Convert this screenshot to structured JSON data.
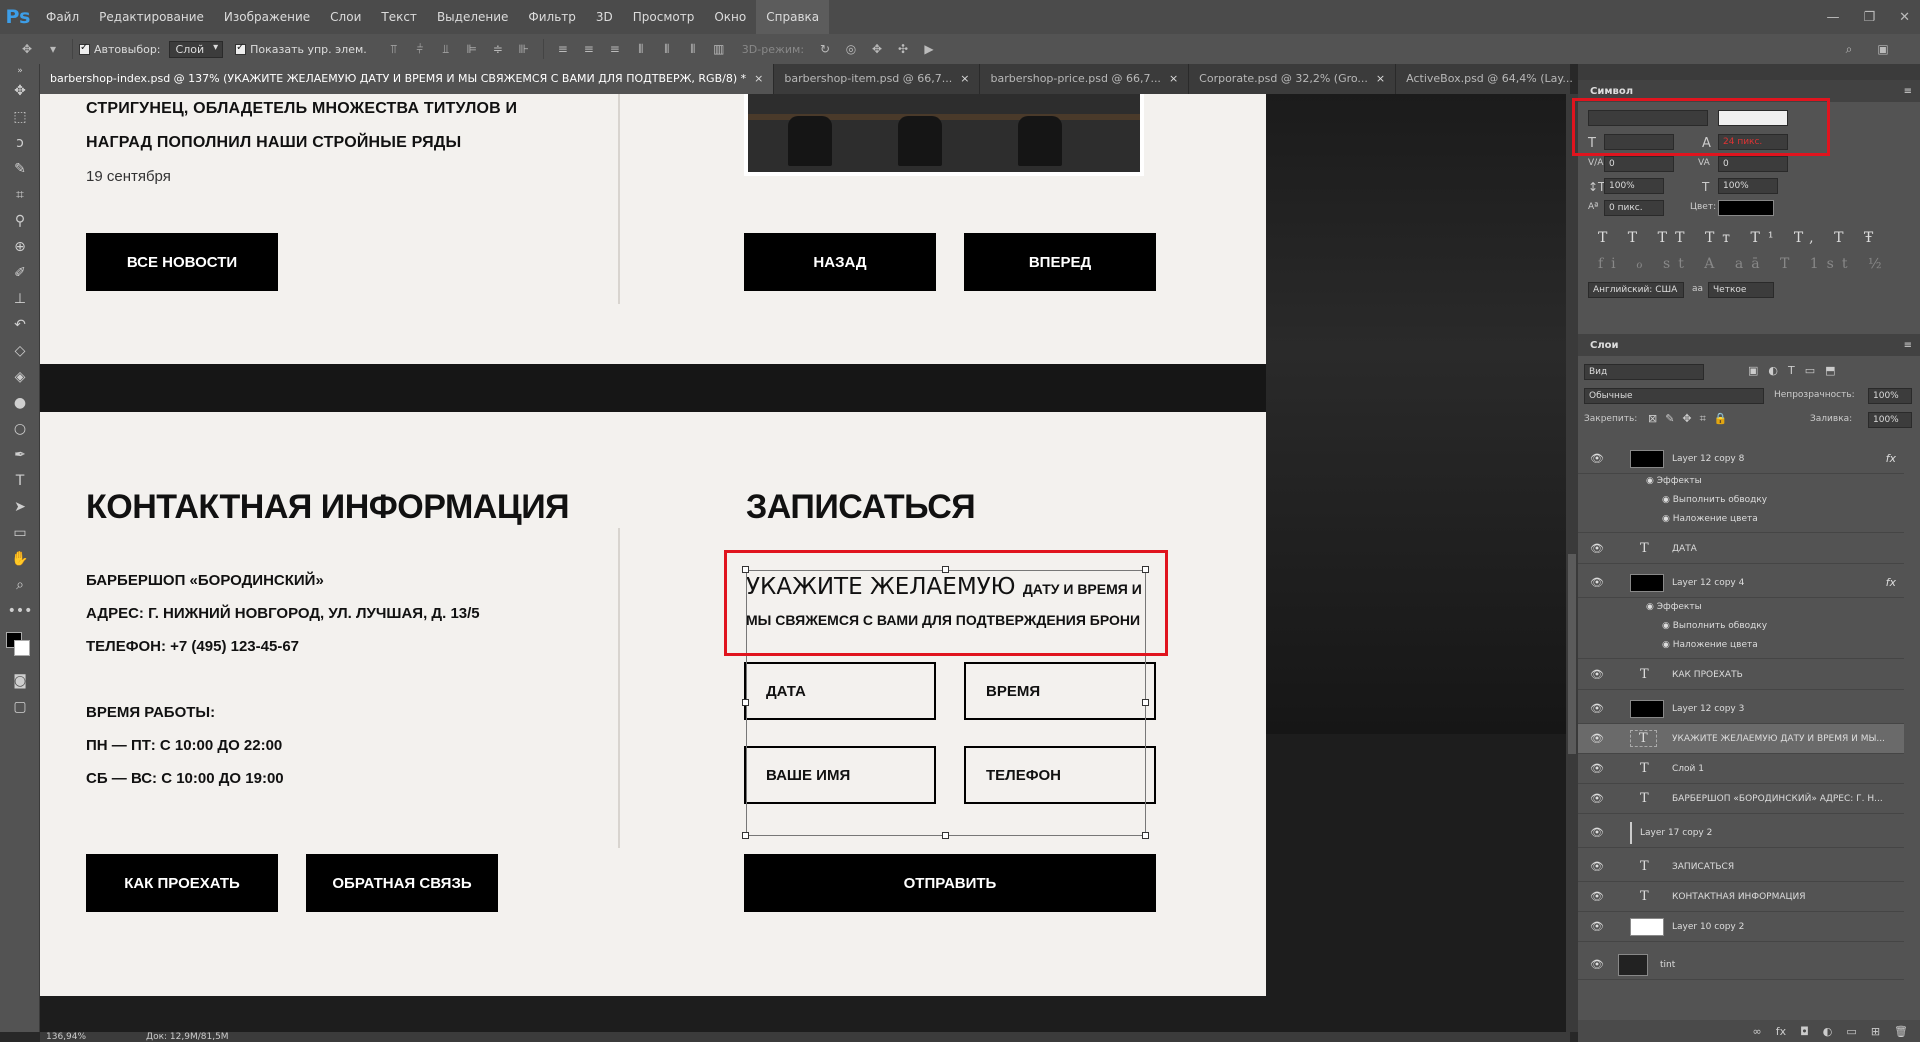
{
  "app": {
    "logo": "Ps"
  },
  "menu": [
    "Файл",
    "Редактирование",
    "Изображение",
    "Слои",
    "Текст",
    "Выделение",
    "Фильтр",
    "3D",
    "Просмотр",
    "Окно",
    "Справка"
  ],
  "options": {
    "autoselect_label": "Автовыбор:",
    "autoselect_value": "Слой",
    "show_controls_label": "Показать упр. элем.",
    "mode_3d": "3D-режим:"
  },
  "tabs": [
    {
      "label": "barbershop-index.psd @ 137% (УКАЖИТЕ ЖЕЛАЕМУЮ ДАТУ И ВРЕМЯ И МЫ СВЯЖЕМСЯ С ВАМИ ДЛЯ ПОДТВЕРЖ, RGB/8) *"
    },
    {
      "label": "barbershop-item.psd @ 66,7..."
    },
    {
      "label": "barbershop-price.psd @ 66,7..."
    },
    {
      "label": "Corporate.psd @ 32,2% (Gro..."
    },
    {
      "label": "ActiveBox.psd @ 64,4% (Lay..."
    }
  ],
  "doc": {
    "news_line1": "СТРИГУНЕЦ, ОБЛАДЕТЕЛЬ МНОЖЕСТВА ТИТУЛОВ И",
    "news_line2": "НАГРАД ПОПОЛНИЛ НАШИ СТРОЙНЫЕ РЯДЫ",
    "news_date": "19 сентября",
    "btn_all_news": "ВСЕ НОВОСТИ",
    "btn_back": "НАЗАД",
    "btn_forward": "ВПЕРЕД",
    "contact_heading": "КОНТАКТНАЯ ИНФОРМАЦИЯ",
    "signup_heading": "ЗАПИСАТЬСЯ",
    "shop_name": "БАРБЕРШОП «БОРОДИНСКИЙ»",
    "address": "АДРЕС: Г. НИЖНИЙ НОВГОРОД, УЛ. ЛУЧШАЯ, Д. 13/5",
    "phone": "ТЕЛЕФОН: +7 (495) 123-45-67",
    "hours_label": "ВРЕМЯ РАБОТЫ:",
    "hours_weekdays": "ПН — ПТ: С 10:00 ДО 22:00",
    "hours_weekend": "СБ — ВС: С 10:00 ДО 19:00",
    "form_text_big": "УКАЖИТЕ ЖЕЛАЕМУЮ",
    "form_text_small": "ДАТУ И ВРЕМЯ И",
    "form_text_line2": "МЫ СВЯЖЕМСЯ С ВАМИ ДЛЯ ПОДТВЕРЖДЕНИЯ БРОНИ",
    "field_date": "ДАТА",
    "field_time": "ВРЕМЯ",
    "field_name": "ВАШЕ ИМЯ",
    "field_phone": "ТЕЛЕФОН",
    "btn_directions": "КАК ПРОЕХАТЬ",
    "btn_feedback": "ОБРАТНАЯ СВЯЗЬ",
    "btn_submit": "ОТПРАВИТЬ"
  },
  "status": {
    "zoom": "136,94%",
    "doc": "Док: 12,9M/81,5M"
  },
  "char_panel": {
    "title": "Символ",
    "size": "24 пикс.",
    "tracking": "0",
    "kerning": "0",
    "vscale": "100%",
    "hscale": "100%",
    "baseline": "0 пикс.",
    "color_label": "Цвет:",
    "language": "Английский: США",
    "aa_label": "аа",
    "antialias": "Четкое",
    "typo_row1": "T T TT Tт T¹ T, T Ŧ",
    "typo_row2": "fi ℴ st A aā T 1st ½"
  },
  "layers_panel": {
    "title": "Слои",
    "filter": "Вид",
    "blend_mode": "Обычные",
    "opacity_label": "Непрозрачность:",
    "opacity": "100%",
    "lock_label": "Закрепить:",
    "fill_label": "Заливка:",
    "fill": "100%",
    "effects_label": "Эффекты",
    "stroke_label": "Выполнить обводку",
    "color_overlay_label": "Наложение цвета",
    "fx_label": "fx",
    "layers": [
      {
        "name": "Layer 12 copy 8",
        "kind": "pixel",
        "fx": true
      },
      {
        "name": "ДАТА",
        "kind": "text"
      },
      {
        "name": "Layer 12 copy 4",
        "kind": "pixel",
        "fx": true
      },
      {
        "name": "КАК ПРОЕХАТЬ",
        "kind": "text"
      },
      {
        "name": "Layer 12 copy 3",
        "kind": "pixel"
      },
      {
        "name": "УКАЖИТЕ ЖЕЛАЕМУЮ ДАТУ И ВРЕМЯ И МЫ...",
        "kind": "text",
        "selected": true
      },
      {
        "name": "Слой 1",
        "kind": "text"
      },
      {
        "name": "БАРБЕРШОП «БОРОДИНСКИЙ» АДРЕС: Г. Н...",
        "kind": "text"
      },
      {
        "name": "Layer 17 copy 2",
        "kind": "line"
      },
      {
        "name": "ЗАПИСАТЬСЯ",
        "kind": "text"
      },
      {
        "name": "КОНТАКТНАЯ ИНФОРМАЦИЯ",
        "kind": "text"
      },
      {
        "name": "Layer 10 copy 2",
        "kind": "white"
      },
      {
        "name": "tint",
        "kind": "photo"
      }
    ]
  },
  "colors": {
    "selection_red": "#e0141e",
    "ps_blue": "#3d9ee8"
  }
}
